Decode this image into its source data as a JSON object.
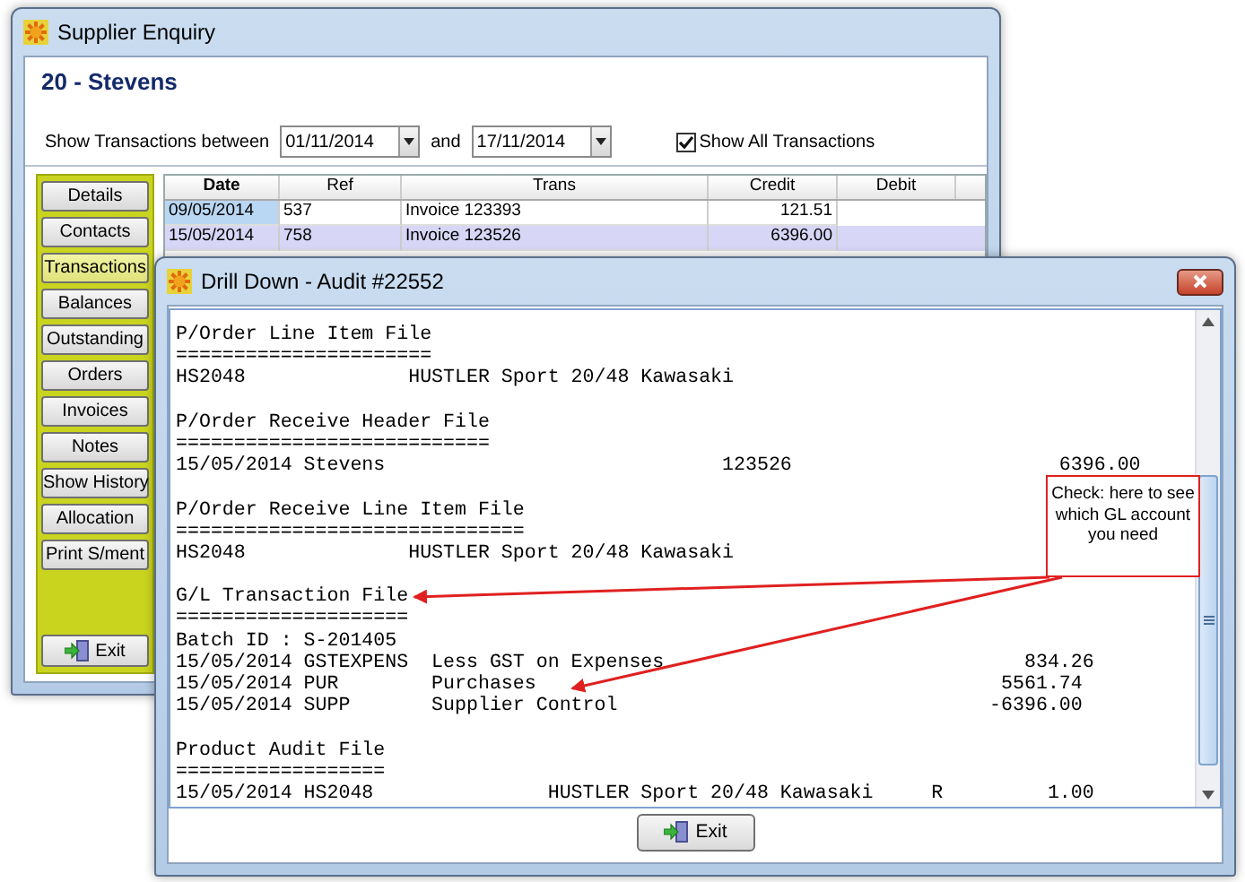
{
  "supplier_window": {
    "title": "Supplier Enquiry",
    "supplier": "20 - Stevens",
    "filter": {
      "label": "Show Transactions between",
      "from": "01/11/2014",
      "joiner": "and",
      "to": "17/11/2014",
      "show_all": {
        "label": "Show All Transactions",
        "checked": true
      }
    },
    "nav": [
      {
        "label": "Details",
        "selected": false
      },
      {
        "label": "Contacts",
        "selected": false
      },
      {
        "label": "Transactions",
        "selected": true
      },
      {
        "label": "Balances",
        "selected": false
      },
      {
        "label": "Outstanding",
        "selected": false
      },
      {
        "label": "Orders",
        "selected": false
      },
      {
        "label": "Invoices",
        "selected": false
      },
      {
        "label": "Notes",
        "selected": false
      },
      {
        "label": "Show History",
        "selected": false
      },
      {
        "label": "Allocation",
        "selected": false
      },
      {
        "label": "Print S/ment",
        "selected": false
      }
    ],
    "exit": "Exit",
    "table": {
      "columns": [
        "Date",
        "Ref",
        "Trans",
        "Credit",
        "Debit"
      ],
      "rows": [
        {
          "date": "09/05/2014",
          "ref": "537",
          "trans": "Invoice 123393",
          "credit": "121.51",
          "selected": false,
          "focused": true
        },
        {
          "date": "15/05/2014",
          "ref": "758",
          "trans": "Invoice 123526",
          "credit": "6396.00",
          "selected": true,
          "focused": false
        }
      ]
    }
  },
  "drill_window": {
    "title": "Drill Down - Audit #22552",
    "sections": [
      {
        "title": "P/Order Line Item File",
        "rule": "======================",
        "lines": [
          "HS2048              HUSTLER Sport 20/48 Kawasaki"
        ]
      },
      {
        "title": "P/Order Receive Header File",
        "rule": "===========================",
        "lines": [
          "15/05/2014 Stevens                             123526                       6396.00"
        ]
      },
      {
        "title": "P/Order Receive Line Item File",
        "rule": "==============================",
        "lines": [
          "HS2048              HUSTLER Sport 20/48 Kawasaki"
        ]
      },
      {
        "title": "G/L Transaction File",
        "rule": "====================",
        "lines": [
          "Batch ID : S-201405",
          "15/05/2014 GSTEXPENS  Less GST on Expenses                               834.26",
          "15/05/2014 PUR        Purchases                                        5561.74",
          "15/05/2014 SUPP       Supplier Control                                -6396.00"
        ]
      },
      {
        "title": "Product Audit File",
        "rule": "==================",
        "lines": [
          "15/05/2014 HS2048               HUSTLER Sport 20/48 Kawasaki     R         1.00"
        ]
      }
    ],
    "callout": "Check: here to see which GL account you need",
    "exit": "Exit"
  }
}
